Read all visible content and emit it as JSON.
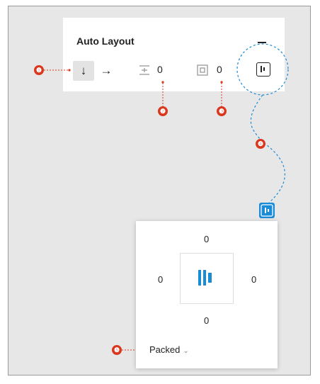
{
  "panel": {
    "title": "Auto Layout",
    "direction": {
      "vertical_icon": "↓",
      "horizontal_icon": "→",
      "selected": "vertical"
    },
    "spacing_between_items": "0",
    "padding": "0",
    "icons": {
      "collapse": "minus-icon",
      "spacing": "spacing-between-icon",
      "padding": "padding-icon",
      "alignment": "alignment-icon"
    }
  },
  "popover": {
    "padding_top": "0",
    "padding_left": "0",
    "padding_right": "0",
    "padding_bottom": "0",
    "distribution": "Packed",
    "chevron": "⌄"
  },
  "callouts": [
    "❶",
    "❷",
    "❸",
    "❹",
    "❺"
  ],
  "colors": {
    "accent": "#1a8bd6",
    "marker": "#d9381e",
    "canvas": "#e7e7e7",
    "panel": "#ffffff"
  }
}
